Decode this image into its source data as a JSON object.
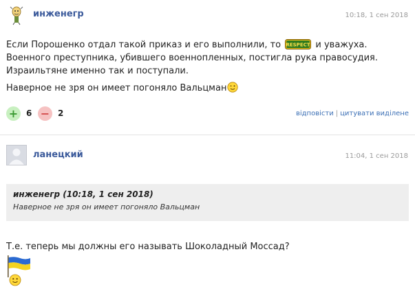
{
  "posts": [
    {
      "username": "инженегр",
      "timestamp": "10:18, 1 сен 2018",
      "line1_before": "Если Порошенко отдал такой приказ и его выполнили, то ",
      "sticker_text": "RESPECT",
      "line1_after": " и уважуха.",
      "line2": "Военного преступника, убившего военнопленных, постигла рука правосудия.",
      "line3": "Израильтяне именно так и поступали.",
      "line4": "Наверное не зря он имеет погоняло Вальцман",
      "votes": {
        "up": "6",
        "down": "2",
        "up_symbol": "+",
        "down_symbol": "−"
      },
      "actions": {
        "reply": "відповісти",
        "separator": "|",
        "quote": "цитувати виділене"
      }
    },
    {
      "username": "ланецкий",
      "timestamp": "11:04, 1 сен 2018",
      "quote": {
        "header": "инженегр (10:18, 1 сен 2018)",
        "text": "Наверное не зря он имеет погоняло Вальцман"
      },
      "text": "Т.е. теперь мы должны его называть Шоколадный Моссад?"
    }
  ],
  "colors": {
    "username": "#3b5a9b",
    "link": "#3b6fb5",
    "vote_up_bg": "#c8f0c0",
    "vote_down_bg": "#f6c2c2",
    "quote_bg": "#eeeeee"
  },
  "icons": {
    "avatar1": "cartoon-avatar-icon",
    "avatar2": "default-user-avatar-icon",
    "flag": "ukraine-flag-icon"
  }
}
